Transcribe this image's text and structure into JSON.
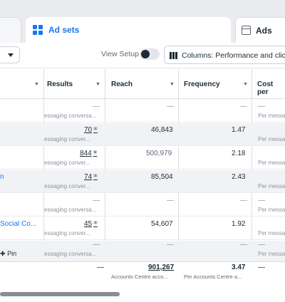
{
  "tabs": {
    "adsets_label": "Ad sets",
    "ads_label": "Ads"
  },
  "toolbar": {
    "view_setup_label": "View Setup",
    "columns_label": "Columns: Performance and clicks"
  },
  "table": {
    "headers": [
      "Results",
      "Reach",
      "Frequency",
      "Cost per"
    ],
    "rows": [
      {
        "name": "",
        "results": "—",
        "results_sub": "essaging conversa...",
        "reach": "—",
        "frequency": "—",
        "cost": "—",
        "cost_sub": "Per messa",
        "shaded": false
      },
      {
        "name": "",
        "results": "70",
        "results_sub": "essaging conver...",
        "reach": "46,843",
        "frequency": "1.47",
        "cost": "",
        "cost_sub": "Per messa",
        "shaded": true
      },
      {
        "name": "",
        "results": "844",
        "results_sub": "essaging conver...",
        "reach": "500,979",
        "frequency": "2.18",
        "cost": "",
        "cost_sub": "Per messa",
        "shaded": false
      },
      {
        "name": "n",
        "results": "74",
        "results_sub": "essaging conver...",
        "reach": "85,504",
        "frequency": "2.43",
        "cost": "",
        "cost_sub": "Per messa",
        "shaded": true
      },
      {
        "name": "",
        "results": "—",
        "results_sub": "essaging conversa...",
        "reach": "—",
        "frequency": "—",
        "cost": "—",
        "cost_sub": "Per messa",
        "shaded": false
      },
      {
        "name": "Social Co...",
        "results": "45",
        "results_sub": "essaging conver...",
        "reach": "54,607",
        "frequency": "1.92",
        "cost": "",
        "cost_sub": "Per messa",
        "shaded": false
      },
      {
        "name": "Pin",
        "results": "—",
        "results_sub": "essaging conversa...",
        "reach": "—",
        "frequency": "—",
        "cost": "—",
        "cost_sub": "Per messa",
        "shaded": true
      }
    ],
    "totals": {
      "results": "—",
      "reach": "901,267",
      "reach_sub": "Accounts Centre acco...",
      "frequency": "3.47",
      "frequency_sub": "Per Accounts Centre a...",
      "cost": "—"
    }
  },
  "icons": {
    "adsets": "grid-icon",
    "ads": "ad-icon",
    "columns": "columns-icon",
    "pin": "pin-icon",
    "sort": "sort-caret-icon",
    "info": "info-icon"
  },
  "colors": {
    "accent": "#1877f2",
    "text": "#1c2b33",
    "muted": "#8d949e",
    "shaded_row": "#f0f2f5"
  }
}
